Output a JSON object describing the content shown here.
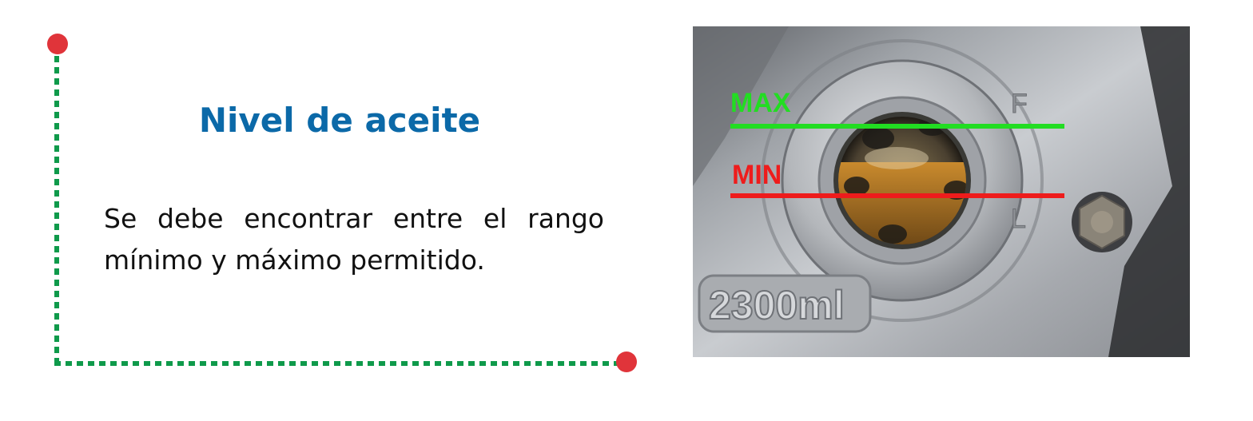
{
  "slide": {
    "title": "Nivel de aceite",
    "body": "Se debe encontrar entre el rango mínimo y máximo permitido."
  },
  "photo": {
    "max_label": "MAX",
    "min_label": "MIN",
    "max_color": "#22dd22",
    "min_color": "#ee1c1c",
    "mark_f": "F",
    "mark_l": "L",
    "capacity_embossing": "2300ml"
  },
  "colors": {
    "title": "#0b69a8",
    "frame_dots": "#0f9a4b",
    "frame_endpoints": "#e0343a"
  }
}
